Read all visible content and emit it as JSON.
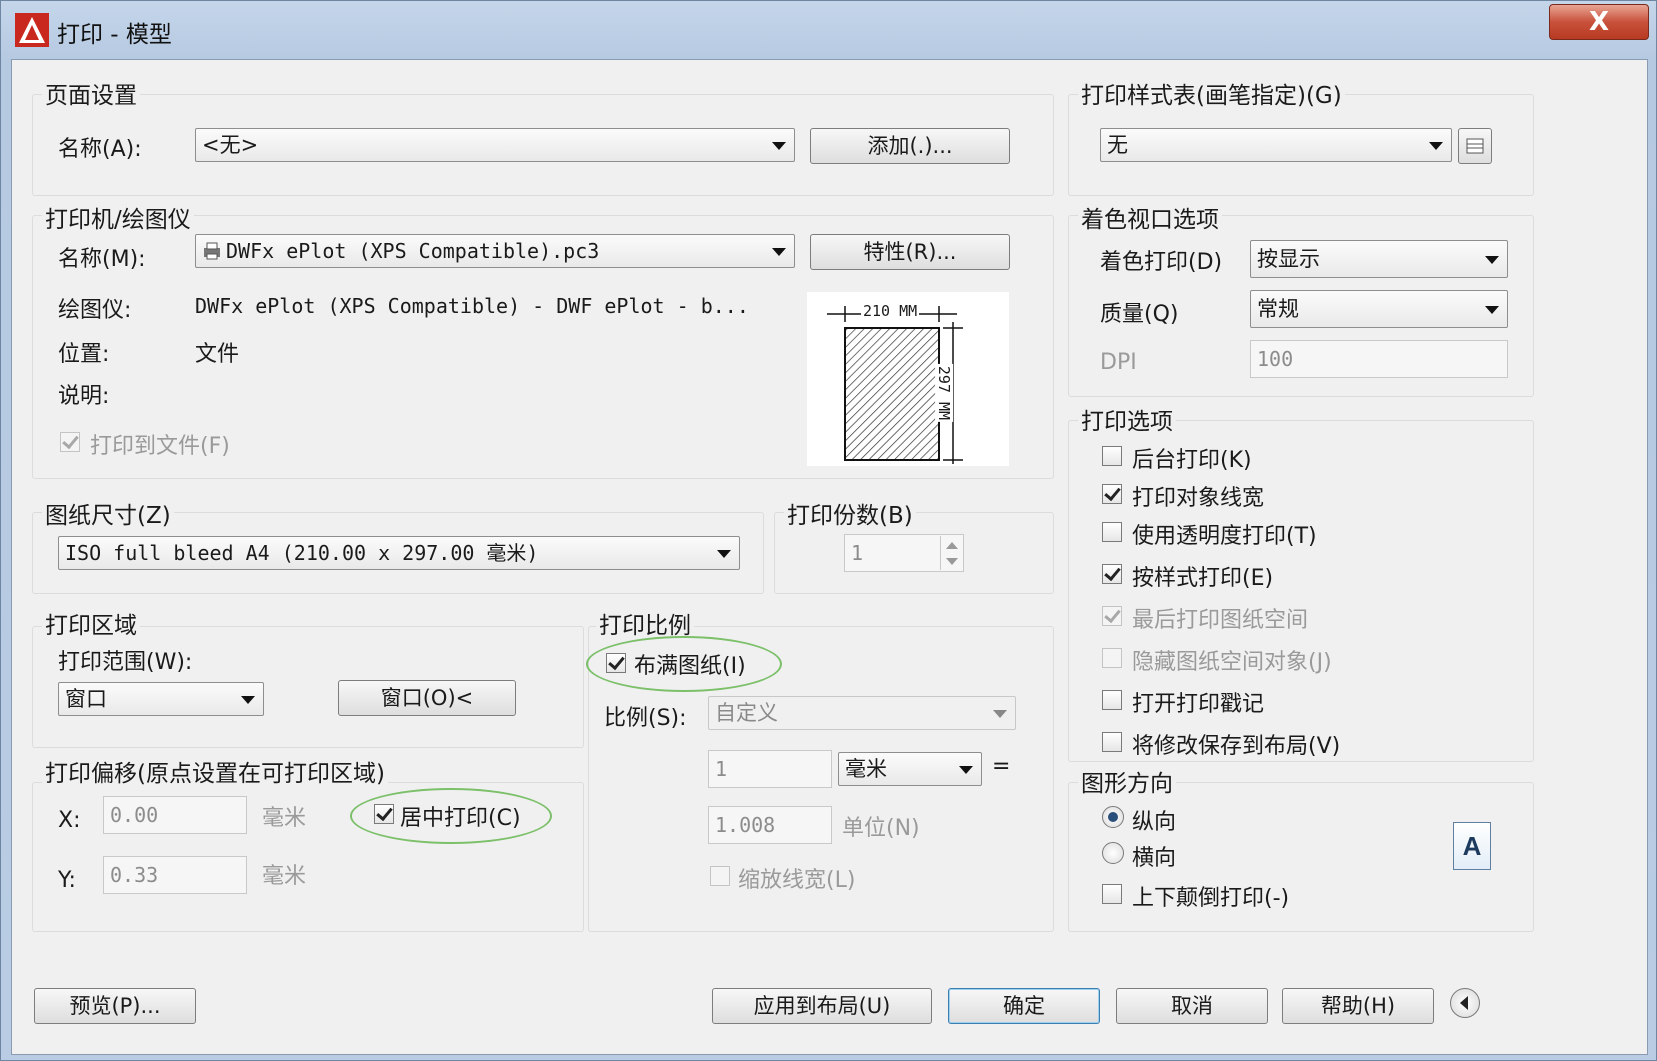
{
  "window": {
    "title": "打印 - 模型",
    "close_label": "X"
  },
  "page_setup": {
    "legend": "页面设置",
    "name_label": "名称(A):",
    "name_value": "<无>",
    "add_button": "添加(.)..."
  },
  "printer": {
    "legend": "打印机/绘图仪",
    "name_label": "名称(M):",
    "name_value": "DWFx ePlot (XPS Compatible).pc3",
    "properties_button": "特性(R)...",
    "plotter_label": "绘图仪:",
    "plotter_value": "DWFx ePlot (XPS Compatible) - DWF ePlot - b...",
    "location_label": "位置:",
    "location_value": "文件",
    "description_label": "说明:",
    "plot_to_file_label": "打印到文件(F)",
    "plot_to_file_checked": true,
    "preview_width_label": "210 MM",
    "preview_height_label": "297 MM"
  },
  "paper_size": {
    "legend": "图纸尺寸(Z)",
    "value": "ISO full bleed A4 (210.00 x 297.00 毫米)"
  },
  "copies": {
    "legend": "打印份数(B)",
    "value": "1"
  },
  "plot_area": {
    "legend": "打印区域",
    "range_label": "打印范围(W):",
    "range_value": "窗口",
    "window_button": "窗口(O)<"
  },
  "plot_offset": {
    "legend": "打印偏移(原点设置在可打印区域)",
    "x_label": "X:",
    "x_value": "0.00",
    "x_unit": "毫米",
    "y_label": "Y:",
    "y_value": "0.33",
    "y_unit": "毫米",
    "center_label": "居中打印(C)",
    "center_checked": true
  },
  "plot_scale": {
    "legend": "打印比例",
    "fit_label": "布满图纸(I)",
    "fit_checked": true,
    "scale_label": "比例(S):",
    "scale_value": "自定义",
    "value1": "1",
    "unit_value": "毫米",
    "equals": "=",
    "value2": "1.008",
    "unit2_label": "单位(N)",
    "scale_lineweights_label": "缩放线宽(L)",
    "scale_lineweights_checked": false
  },
  "plot_style_table": {
    "legend": "打印样式表(画笔指定)(G)",
    "value": "无"
  },
  "shaded_viewport": {
    "legend": "着色视口选项",
    "shade_label": "着色打印(D)",
    "shade_value": "按显示",
    "quality_label": "质量(Q)",
    "quality_value": "常规",
    "dpi_label": "DPI",
    "dpi_value": "100"
  },
  "plot_options": {
    "legend": "打印选项",
    "items": [
      {
        "label": "后台打印(K)",
        "checked": false,
        "enabled": true
      },
      {
        "label": "打印对象线宽",
        "checked": true,
        "enabled": true
      },
      {
        "label": "使用透明度打印(T)",
        "checked": false,
        "enabled": true
      },
      {
        "label": "按样式打印(E)",
        "checked": true,
        "enabled": true
      },
      {
        "label": "最后打印图纸空间",
        "checked": true,
        "enabled": false
      },
      {
        "label": "隐藏图纸空间对象(J)",
        "checked": false,
        "enabled": false
      },
      {
        "label": "打开打印戳记",
        "checked": false,
        "enabled": true
      },
      {
        "label": "将修改保存到布局(V)",
        "checked": false,
        "enabled": true
      }
    ]
  },
  "orientation": {
    "legend": "图形方向",
    "portrait_label": "纵向",
    "landscape_label": "横向",
    "selected": "portrait",
    "upside_down_label": "上下颠倒打印(-)",
    "upside_down_checked": false,
    "icon_letter": "A"
  },
  "footer": {
    "preview_button": "预览(P)...",
    "apply_button": "应用到布局(U)",
    "ok_button": "确定",
    "cancel_button": "取消",
    "help_button": "帮助(H)"
  }
}
